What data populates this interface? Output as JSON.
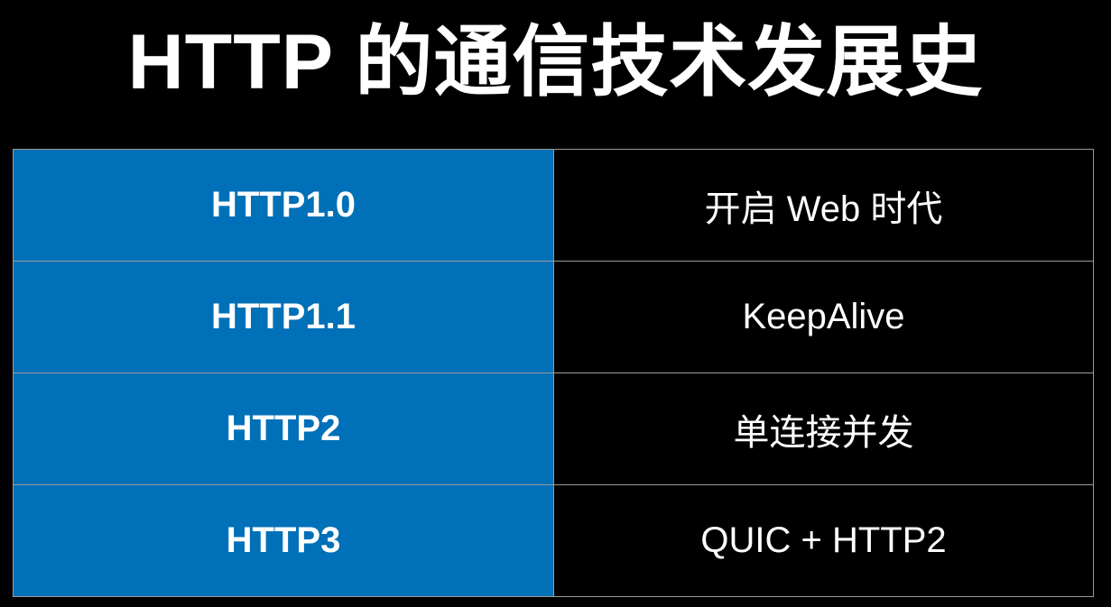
{
  "title": "HTTP 的通信技术发展史",
  "colors": {
    "background": "#000000",
    "version_cell": "#0070b8",
    "border": "#9a9a9a",
    "text": "#ffffff"
  },
  "rows": [
    {
      "version": "HTTP1.0",
      "description": "开启 Web 时代"
    },
    {
      "version": "HTTP1.1",
      "description": "KeepAlive"
    },
    {
      "version": "HTTP2",
      "description": "单连接并发"
    },
    {
      "version": "HTTP3",
      "description": "QUIC + HTTP2"
    }
  ]
}
